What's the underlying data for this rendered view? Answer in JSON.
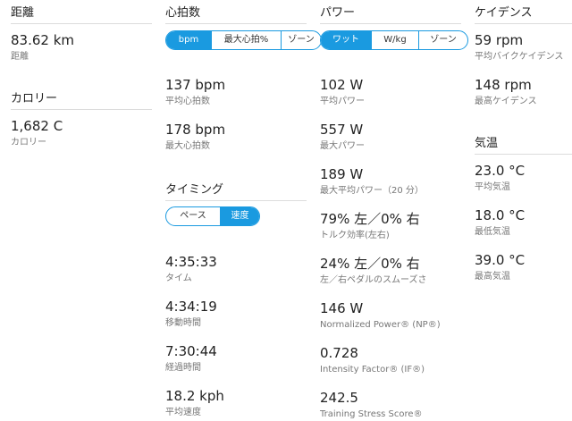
{
  "distance": {
    "title": "距離",
    "value": "83.62 km",
    "label": "距離"
  },
  "calories": {
    "title": "カロリー",
    "value": "1,682 C",
    "label": "カロリー"
  },
  "heart_rate": {
    "title": "心拍数",
    "tabs": [
      "bpm",
      "最大心拍%",
      "ゾーン"
    ],
    "active_tab": "bpm",
    "stats": [
      {
        "value": "137 bpm",
        "label": "平均心拍数"
      },
      {
        "value": "178 bpm",
        "label": "最大心拍数"
      }
    ]
  },
  "timing": {
    "title": "タイミング",
    "tabs": [
      "ペース",
      "速度"
    ],
    "active_tab": "速度",
    "stats": [
      {
        "value": "4:35:33",
        "label": "タイム"
      },
      {
        "value": "4:34:19",
        "label": "移動時間"
      },
      {
        "value": "7:30:44",
        "label": "経過時間"
      },
      {
        "value": "18.2 kph",
        "label": "平均速度"
      }
    ]
  },
  "power": {
    "title": "パワー",
    "tabs": [
      "ワット",
      "W/kg",
      "ゾーン"
    ],
    "active_tab": "ワット",
    "stats": [
      {
        "value": "102 W",
        "label": "平均パワー"
      },
      {
        "value": "557 W",
        "label": "最大パワー"
      },
      {
        "value": "189 W",
        "label": "最大平均パワー（20 分）"
      },
      {
        "value": "79% 左／0% 右",
        "label": "トルク効率(左右)"
      },
      {
        "value": "24% 左／0% 右",
        "label": "左／右ペダルのスムーズさ"
      },
      {
        "value": "146 W",
        "label": "Normalized Power® (NP®)"
      },
      {
        "value": "0.728",
        "label": "Intensity Factor® (IF®)"
      },
      {
        "value": "242.5",
        "label": "Training Stress Score®"
      }
    ]
  },
  "cadence": {
    "title": "ケイデンス",
    "stats": [
      {
        "value": "59 rpm",
        "label": "平均バイクケイデンス"
      },
      {
        "value": "148 rpm",
        "label": "最高ケイデンス"
      }
    ]
  },
  "temperature": {
    "title": "気温",
    "stats": [
      {
        "value": "23.0 °C",
        "label": "平均気温"
      },
      {
        "value": "18.0 °C",
        "label": "最低気温"
      },
      {
        "value": "39.0 °C",
        "label": "最高気温"
      }
    ]
  },
  "colors": {
    "accent": "#1a9ae0",
    "divider": "#dcdcdc",
    "label": "#777777"
  }
}
